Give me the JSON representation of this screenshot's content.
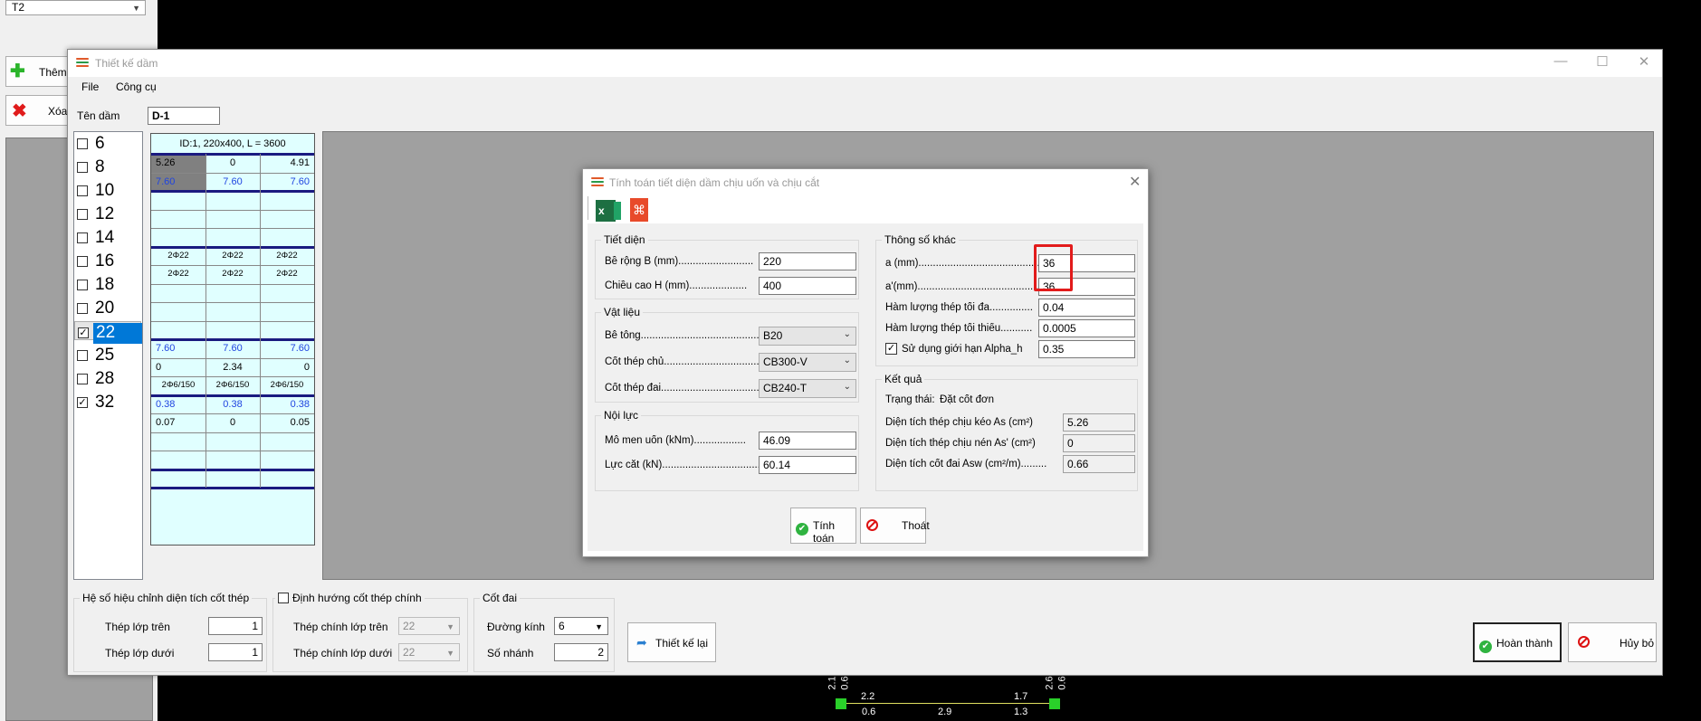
{
  "background": {
    "dropdown_value": "T2",
    "add_button": "Thêm",
    "delete_button": "Xóa"
  },
  "bottom_diagram": {
    "labels_top": [
      "2.1",
      "0.6",
      "2.6",
      "0.6"
    ],
    "labels_mid": [
      "2.2",
      "1.7"
    ],
    "labels_bottom": [
      "0.6",
      "2.9",
      "1.3"
    ]
  },
  "window": {
    "title": "Thiết kế dầm",
    "menu": [
      "File",
      "Công cụ"
    ],
    "beam_name_label": "Tên dầm",
    "beam_name_value": "D-1"
  },
  "diameter_list": [
    {
      "label": "6",
      "checked": false,
      "selected": false
    },
    {
      "label": "8",
      "checked": false,
      "selected": false
    },
    {
      "label": "10",
      "checked": false,
      "selected": false
    },
    {
      "label": "12",
      "checked": false,
      "selected": false
    },
    {
      "label": "14",
      "checked": false,
      "selected": false
    },
    {
      "label": "16",
      "checked": false,
      "selected": false
    },
    {
      "label": "18",
      "checked": false,
      "selected": false
    },
    {
      "label": "20",
      "checked": false,
      "selected": false
    },
    {
      "label": "22",
      "checked": true,
      "selected": true
    },
    {
      "label": "25",
      "checked": false,
      "selected": false
    },
    {
      "label": "28",
      "checked": false,
      "selected": false
    },
    {
      "label": "32",
      "checked": true,
      "selected": false
    }
  ],
  "beam_grid": {
    "header": "ID:1, 220x400, L = 3600",
    "rows": [
      [
        "5.26",
        "0",
        "4.91"
      ],
      [
        "7.60",
        "7.60",
        "7.60"
      ],
      [
        "",
        "",
        ""
      ],
      [
        "",
        "",
        ""
      ],
      [
        "",
        "",
        ""
      ],
      [
        "2Φ22",
        "2Φ22",
        "2Φ22"
      ],
      [
        "2Φ22",
        "2Φ22",
        "2Φ22"
      ],
      [
        "",
        "",
        ""
      ],
      [
        "",
        "",
        ""
      ],
      [
        "",
        "",
        ""
      ],
      [
        "7.60",
        "7.60",
        "7.60"
      ],
      [
        "0",
        "2.34",
        "0"
      ],
      [
        "2Φ6/150",
        "2Φ6/150",
        "2Φ6/150"
      ],
      [
        "0.38",
        "0.38",
        "0.38"
      ],
      [
        "0.07",
        "0",
        "0.05"
      ],
      [
        "",
        "",
        ""
      ],
      [
        "",
        "",
        ""
      ],
      [
        "",
        "",
        ""
      ]
    ]
  },
  "bottom_panel": {
    "coef_group_title": "Hệ số hiệu chỉnh diện tích cốt thép",
    "top_steel_label": "Thép lớp trên",
    "top_steel_value": "1",
    "bottom_steel_label": "Thép lớp dưới",
    "bottom_steel_value": "1",
    "orient_group_title": "Định hướng cốt thép chính",
    "main_top_label": "Thép chính lớp trên",
    "main_top_value": "22",
    "main_bottom_label": "Thép chính lớp dưới",
    "main_bottom_value": "22",
    "stirrup_group_title": "Cốt đai",
    "diameter_label": "Đường kính",
    "diameter_value": "6",
    "branches_label": "Số nhánh",
    "branches_value": "2",
    "redesign_button": "Thiết kế lại",
    "finish_button": "Hoàn thành",
    "cancel_button": "Hủy bỏ"
  },
  "dialog": {
    "title": "Tính toán tiết diện dầm chịu uốn và chịu cắt",
    "section_group": "Tiết diện",
    "width_label": "Bề rộng B (mm)..........................",
    "width_value": "220",
    "height_label": "Chiều cao H (mm)....................",
    "height_value": "400",
    "material_group": "Vật liệu",
    "concrete_label": "Bê tông.............................................",
    "concrete_value": "B20",
    "main_steel_label": "Cốt thép chủ.................................",
    "main_steel_value": "CB300-V",
    "stirrup_steel_label": "Cốt thép đai....................................",
    "stirrup_steel_value": "CB240-T",
    "force_group": "Nội lực",
    "moment_label": "Mô men uốn (kNm)..................",
    "moment_value": "46.09",
    "shear_label": "Lực cắt (kN)..................................",
    "shear_value": "60.14",
    "other_group": "Thông số khác",
    "a_label": "a (mm)...................................................",
    "a_value": "36",
    "a2_label": "a'(mm)....................................................",
    "a2_value": "36",
    "max_ratio_label": "Hàm lượng thép tối đa...............",
    "max_ratio_value": "0.04",
    "min_ratio_label": "Hàm lượng thép tối thiểu...........",
    "min_ratio_value": "0.0005",
    "alpha_label": "Sử dụng giới hạn Alpha_h",
    "alpha_value": "0.35",
    "alpha_checked": true,
    "result_group": "Kết quả",
    "status_label": "Trạng thái:",
    "status_value": "Đặt cốt đơn",
    "as_label": "Diện tích thép chịu kéo As (cm²)",
    "as_value": "5.26",
    "as2_label": "Diện tích thép chịu nén As' (cm²)",
    "as2_value": "0",
    "asw_label": "Diện tích cốt đai Asw (cm²/m).........",
    "asw_value": "0.66",
    "calc_button": "Tính toán",
    "exit_button": "Thoát"
  }
}
